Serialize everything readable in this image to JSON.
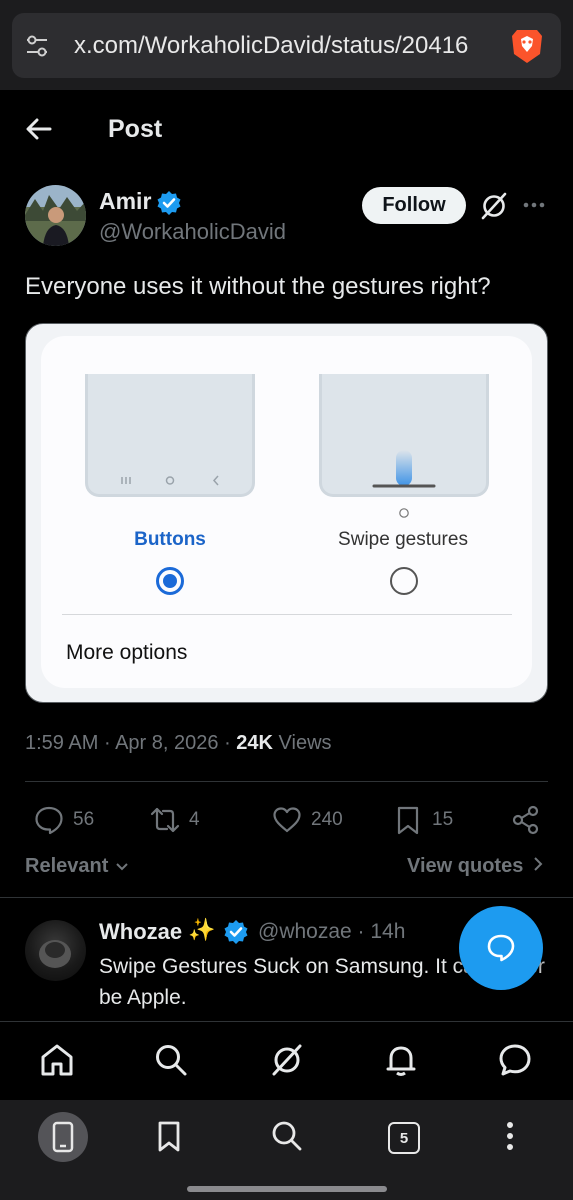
{
  "browser": {
    "url": "x.com/WorkaholicDavid/status/20416",
    "tab_count": "5"
  },
  "header": {
    "title": "Post"
  },
  "post": {
    "author_name": "Amir",
    "author_handle": "@WorkaholicDavid",
    "follow_label": "Follow",
    "text": "Everyone uses it without the gestures right?",
    "image": {
      "option_buttons": "Buttons",
      "option_swipe": "Swipe gestures",
      "more_options": "More options",
      "selected": "Buttons"
    },
    "time": "1:59 AM",
    "date": "Apr 8, 2026",
    "views_count": "24K",
    "views_label": "Views",
    "replies": "56",
    "reposts": "4",
    "likes": "240",
    "bookmarks": "15"
  },
  "filters": {
    "sort_label": "Relevant",
    "view_quotes": "View quotes"
  },
  "reply": {
    "name": "Whozae",
    "emoji": "✨",
    "handle": "@whozae · 14h",
    "text": "Swipe Gestures Suck on Samsung. It can never be Apple."
  },
  "colors": {
    "accent": "#1d9bf0",
    "background": "#000000",
    "muted": "#71767b"
  },
  "icons": {
    "x_nav": [
      "home-icon",
      "search-icon",
      "grok-icon",
      "notifications-icon",
      "messages-icon"
    ],
    "browser_nav": [
      "tab-icon",
      "bookmark-icon",
      "search-icon",
      "tabs-icon",
      "menu-icon"
    ]
  }
}
